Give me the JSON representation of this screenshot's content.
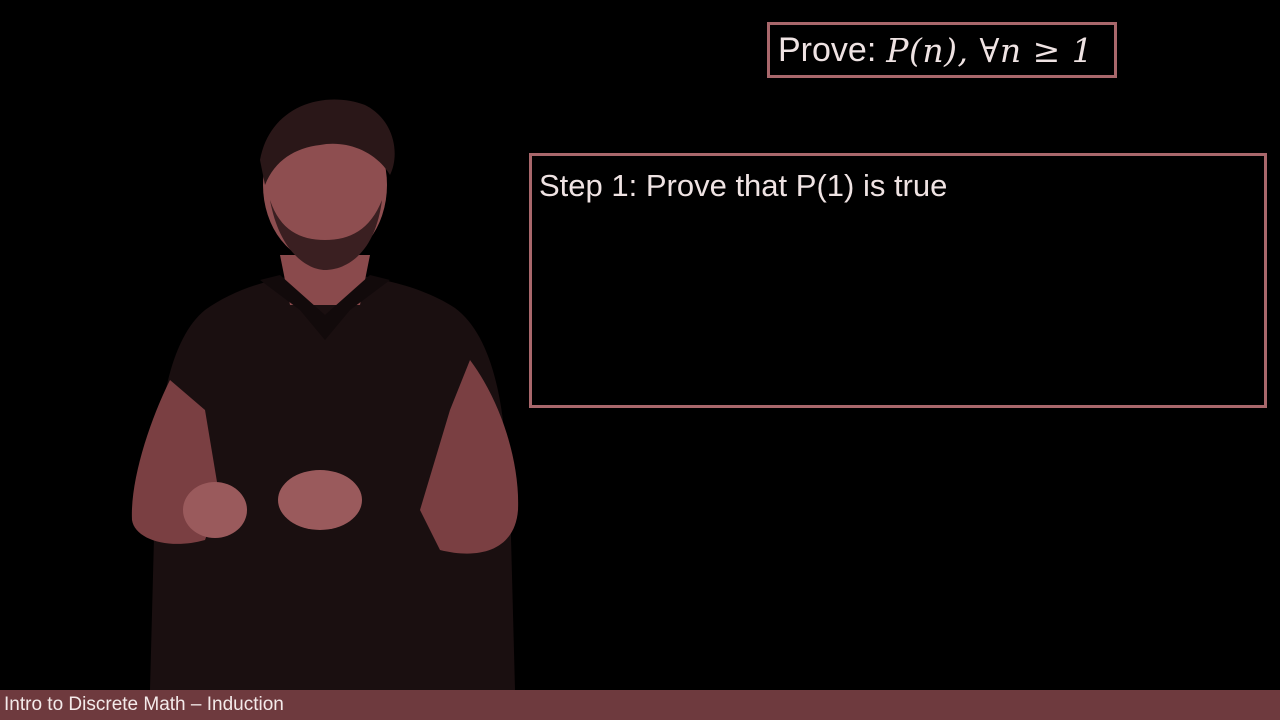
{
  "colors": {
    "background": "#000000",
    "box_border": "#a8676b",
    "text": "#efe3e3",
    "footer_background": "#6e3a3e",
    "presenter_tint": "#8a4a4c"
  },
  "prove_box": {
    "label": "Prove:",
    "formula": "P(n), ∀n ≥ 1"
  },
  "step_box": {
    "text": "Step 1: Prove that P(1) is true"
  },
  "footer": {
    "text": "Intro to Discrete Math – Induction"
  },
  "presenter": {
    "icon": "presenter-figure"
  }
}
